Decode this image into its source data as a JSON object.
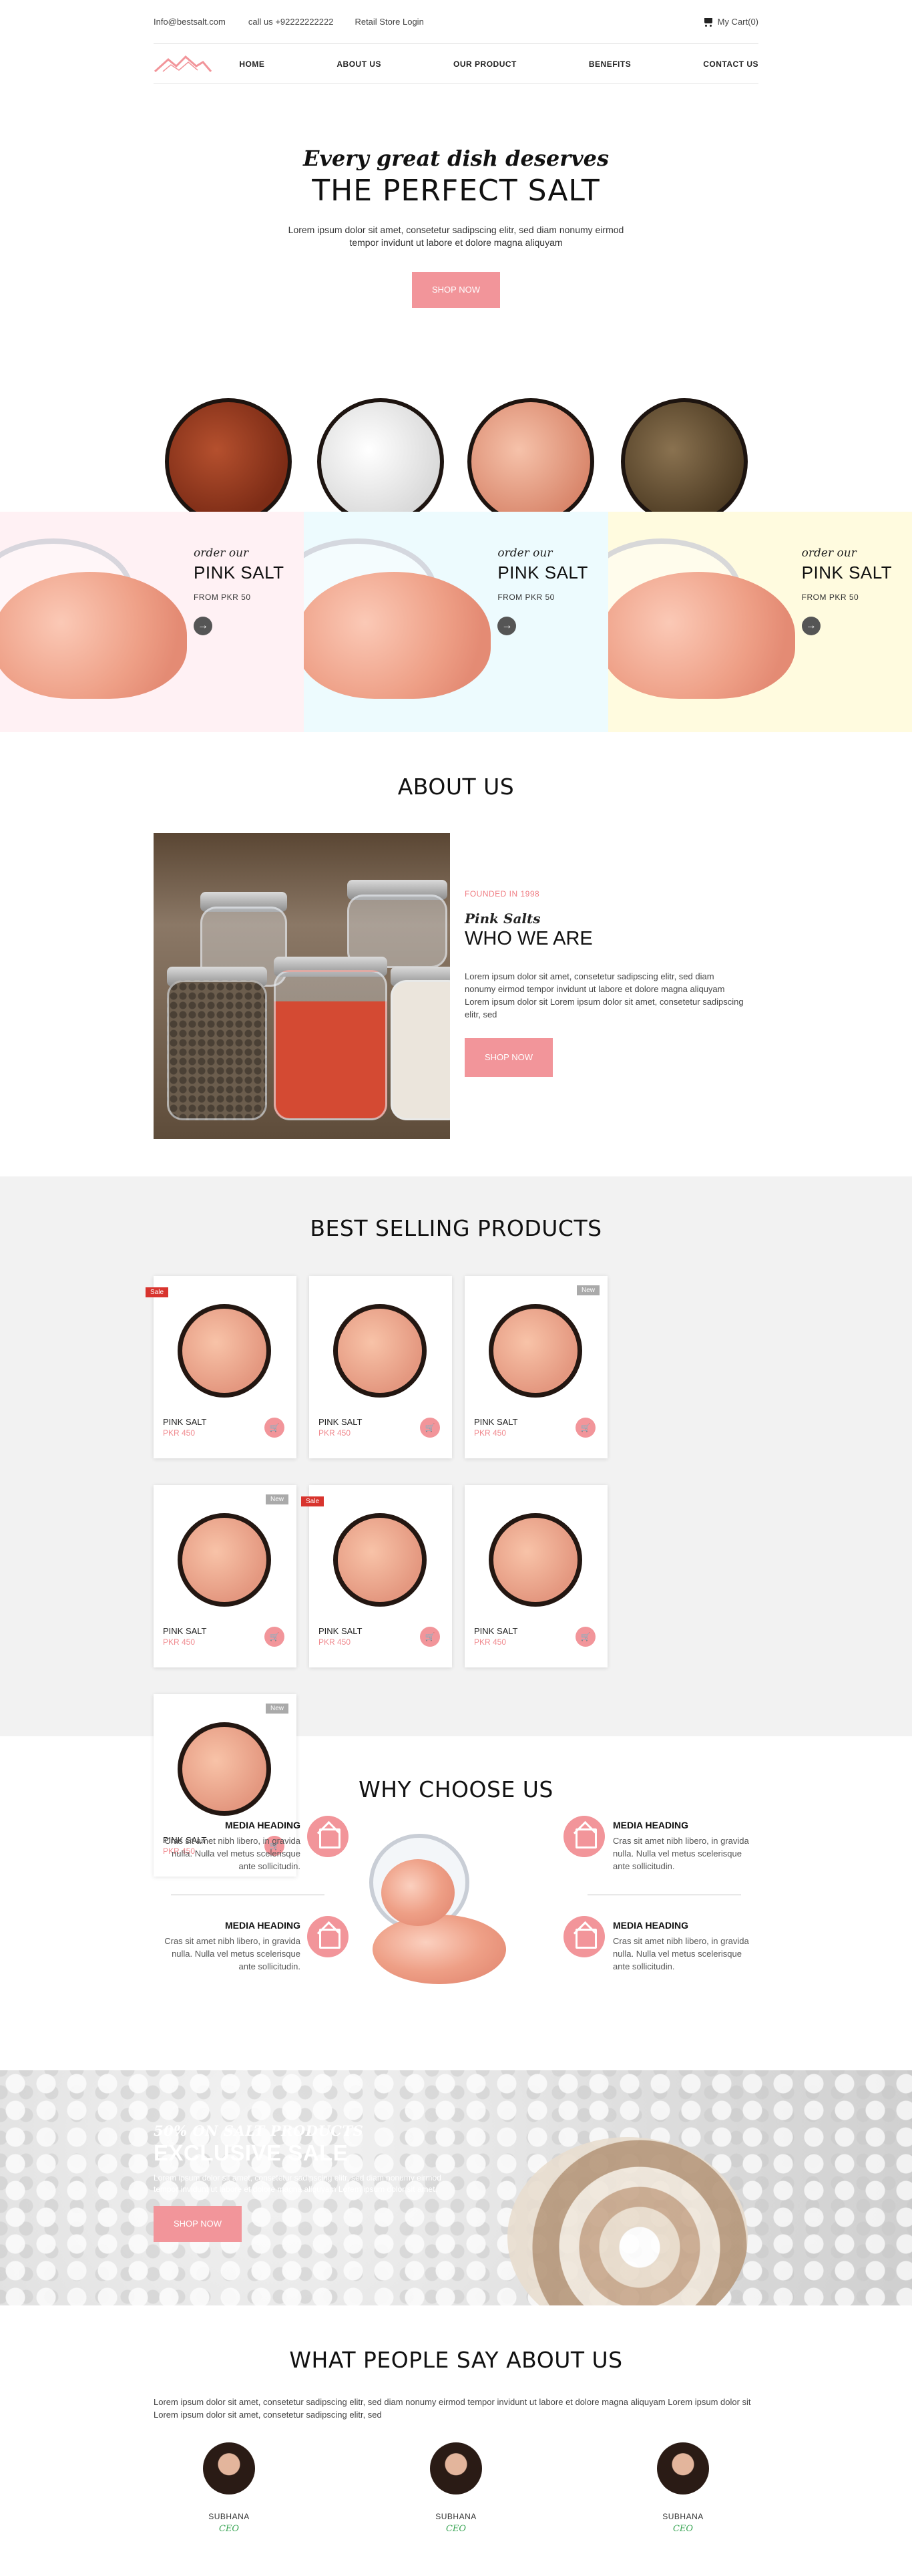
{
  "topbar": {
    "email": "Info@bestsalt.com",
    "phone": "call us +92222222222",
    "retail_login": "Retail Store Login",
    "cart": "My Cart(0)"
  },
  "nav": {
    "items": [
      "HOME",
      "ABOUT US",
      "OUR PRODUCT",
      "BENEFITS",
      "CONTACT US"
    ]
  },
  "hero": {
    "kicker": "Every great dish deserves",
    "title": "THE PERFECT SALT",
    "text": "Lorem ipsum dolor sit amet, consetetur sadipscing elitr, sed diam nonumy eirmod tempor invidunt ut labore et dolore magna aliquyam",
    "button": "SHOP NOW"
  },
  "promos": [
    {
      "order": "order our",
      "name": "PINK SALT",
      "price": "FROM PKR 50",
      "color": "#fff1f4"
    },
    {
      "order": "order our",
      "name": "PINK SALT",
      "price": "FROM PKR 50",
      "color": "#edfbfe"
    },
    {
      "order": "order our",
      "name": "PINK SALT",
      "price": "FROM PKR 50",
      "color": "#fffbdf"
    }
  ],
  "about": {
    "title": "ABOUT US",
    "founded": "FOUNDED IN 1998",
    "sub": "Pink Salts",
    "heading": "WHO WE ARE",
    "text": "Lorem ipsum dolor sit amet, consetetur sadipscing elitr, sed diam nonumy eirmod tempor invidunt ut labore et dolore magna aliquyam Lorem ipsum dolor sit Lorem ipsum dolor sit amet, consetetur sadipscing elitr, sed",
    "button": "SHOP NOW"
  },
  "products": {
    "title": "BEST SELLING PRODUCTS",
    "items": [
      {
        "name": "PINK SALT",
        "price": "PKR 450",
        "badge": "Sale"
      },
      {
        "name": "PINK SALT",
        "price": "PKR 450",
        "badge": ""
      },
      {
        "name": "PINK SALT",
        "price": "PKR 450",
        "badge": "New"
      },
      {
        "name": "PINK SALT",
        "price": "PKR 450",
        "badge": "New"
      },
      {
        "name": "PINK SALT",
        "price": "PKR 450",
        "badge": "Sale"
      },
      {
        "name": "PINK SALT",
        "price": "PKR 450",
        "badge": ""
      },
      {
        "name": "PINK SALT",
        "price": "PKR 450",
        "badge": "New"
      }
    ]
  },
  "why": {
    "title": "WHY CHOOSE US",
    "features": [
      {
        "heading": "MEDIA HEADING",
        "text": "Cras sit amet nibh libero, in gravida nulla. Nulla vel metus scelerisque ante sollicitudin."
      },
      {
        "heading": "MEDIA HEADING",
        "text": "Cras sit amet nibh libero, in gravida nulla. Nulla vel metus scelerisque ante sollicitudin."
      },
      {
        "heading": "MEDIA HEADING",
        "text": "Cras sit amet nibh libero, in gravida nulla. Nulla vel metus scelerisque ante sollicitudin."
      },
      {
        "heading": "MEDIA HEADING",
        "text": "Cras sit amet nibh libero, in gravida nulla. Nulla vel metus scelerisque ante sollicitudin."
      }
    ]
  },
  "sale": {
    "kicker": "50% ON SALT PRODUCTS",
    "title": "EXCLUSIVE SALE",
    "text": "Lorem ipsum dolor sit amet, consetetur sadipscing elitr, sed diam nonumy eirmod tempor invidunt ut labore et dolore magna aliquyam Lorem ipsum dolor sit amet.",
    "button": "SHOP NOW"
  },
  "testimonials": {
    "title": "WHAT PEOPLE SAY ABOUT US",
    "text": "Lorem ipsum dolor sit amet, consetetur sadipscing elitr, sed diam nonumy eirmod tempor invidunt ut labore et dolore magna aliquyam Lorem ipsum dolor sit Lorem ipsum dolor sit amet, consetetur sadipscing elitr, sed",
    "people": [
      {
        "name": "SUBHANA",
        "role": "CEO"
      },
      {
        "name": "SUBHANA",
        "role": "CEO"
      },
      {
        "name": "SUBHANA",
        "role": "CEO"
      }
    ]
  },
  "colors": {
    "accent": "#f2959a",
    "price": "#f08a8f",
    "role": "#3aa655"
  }
}
